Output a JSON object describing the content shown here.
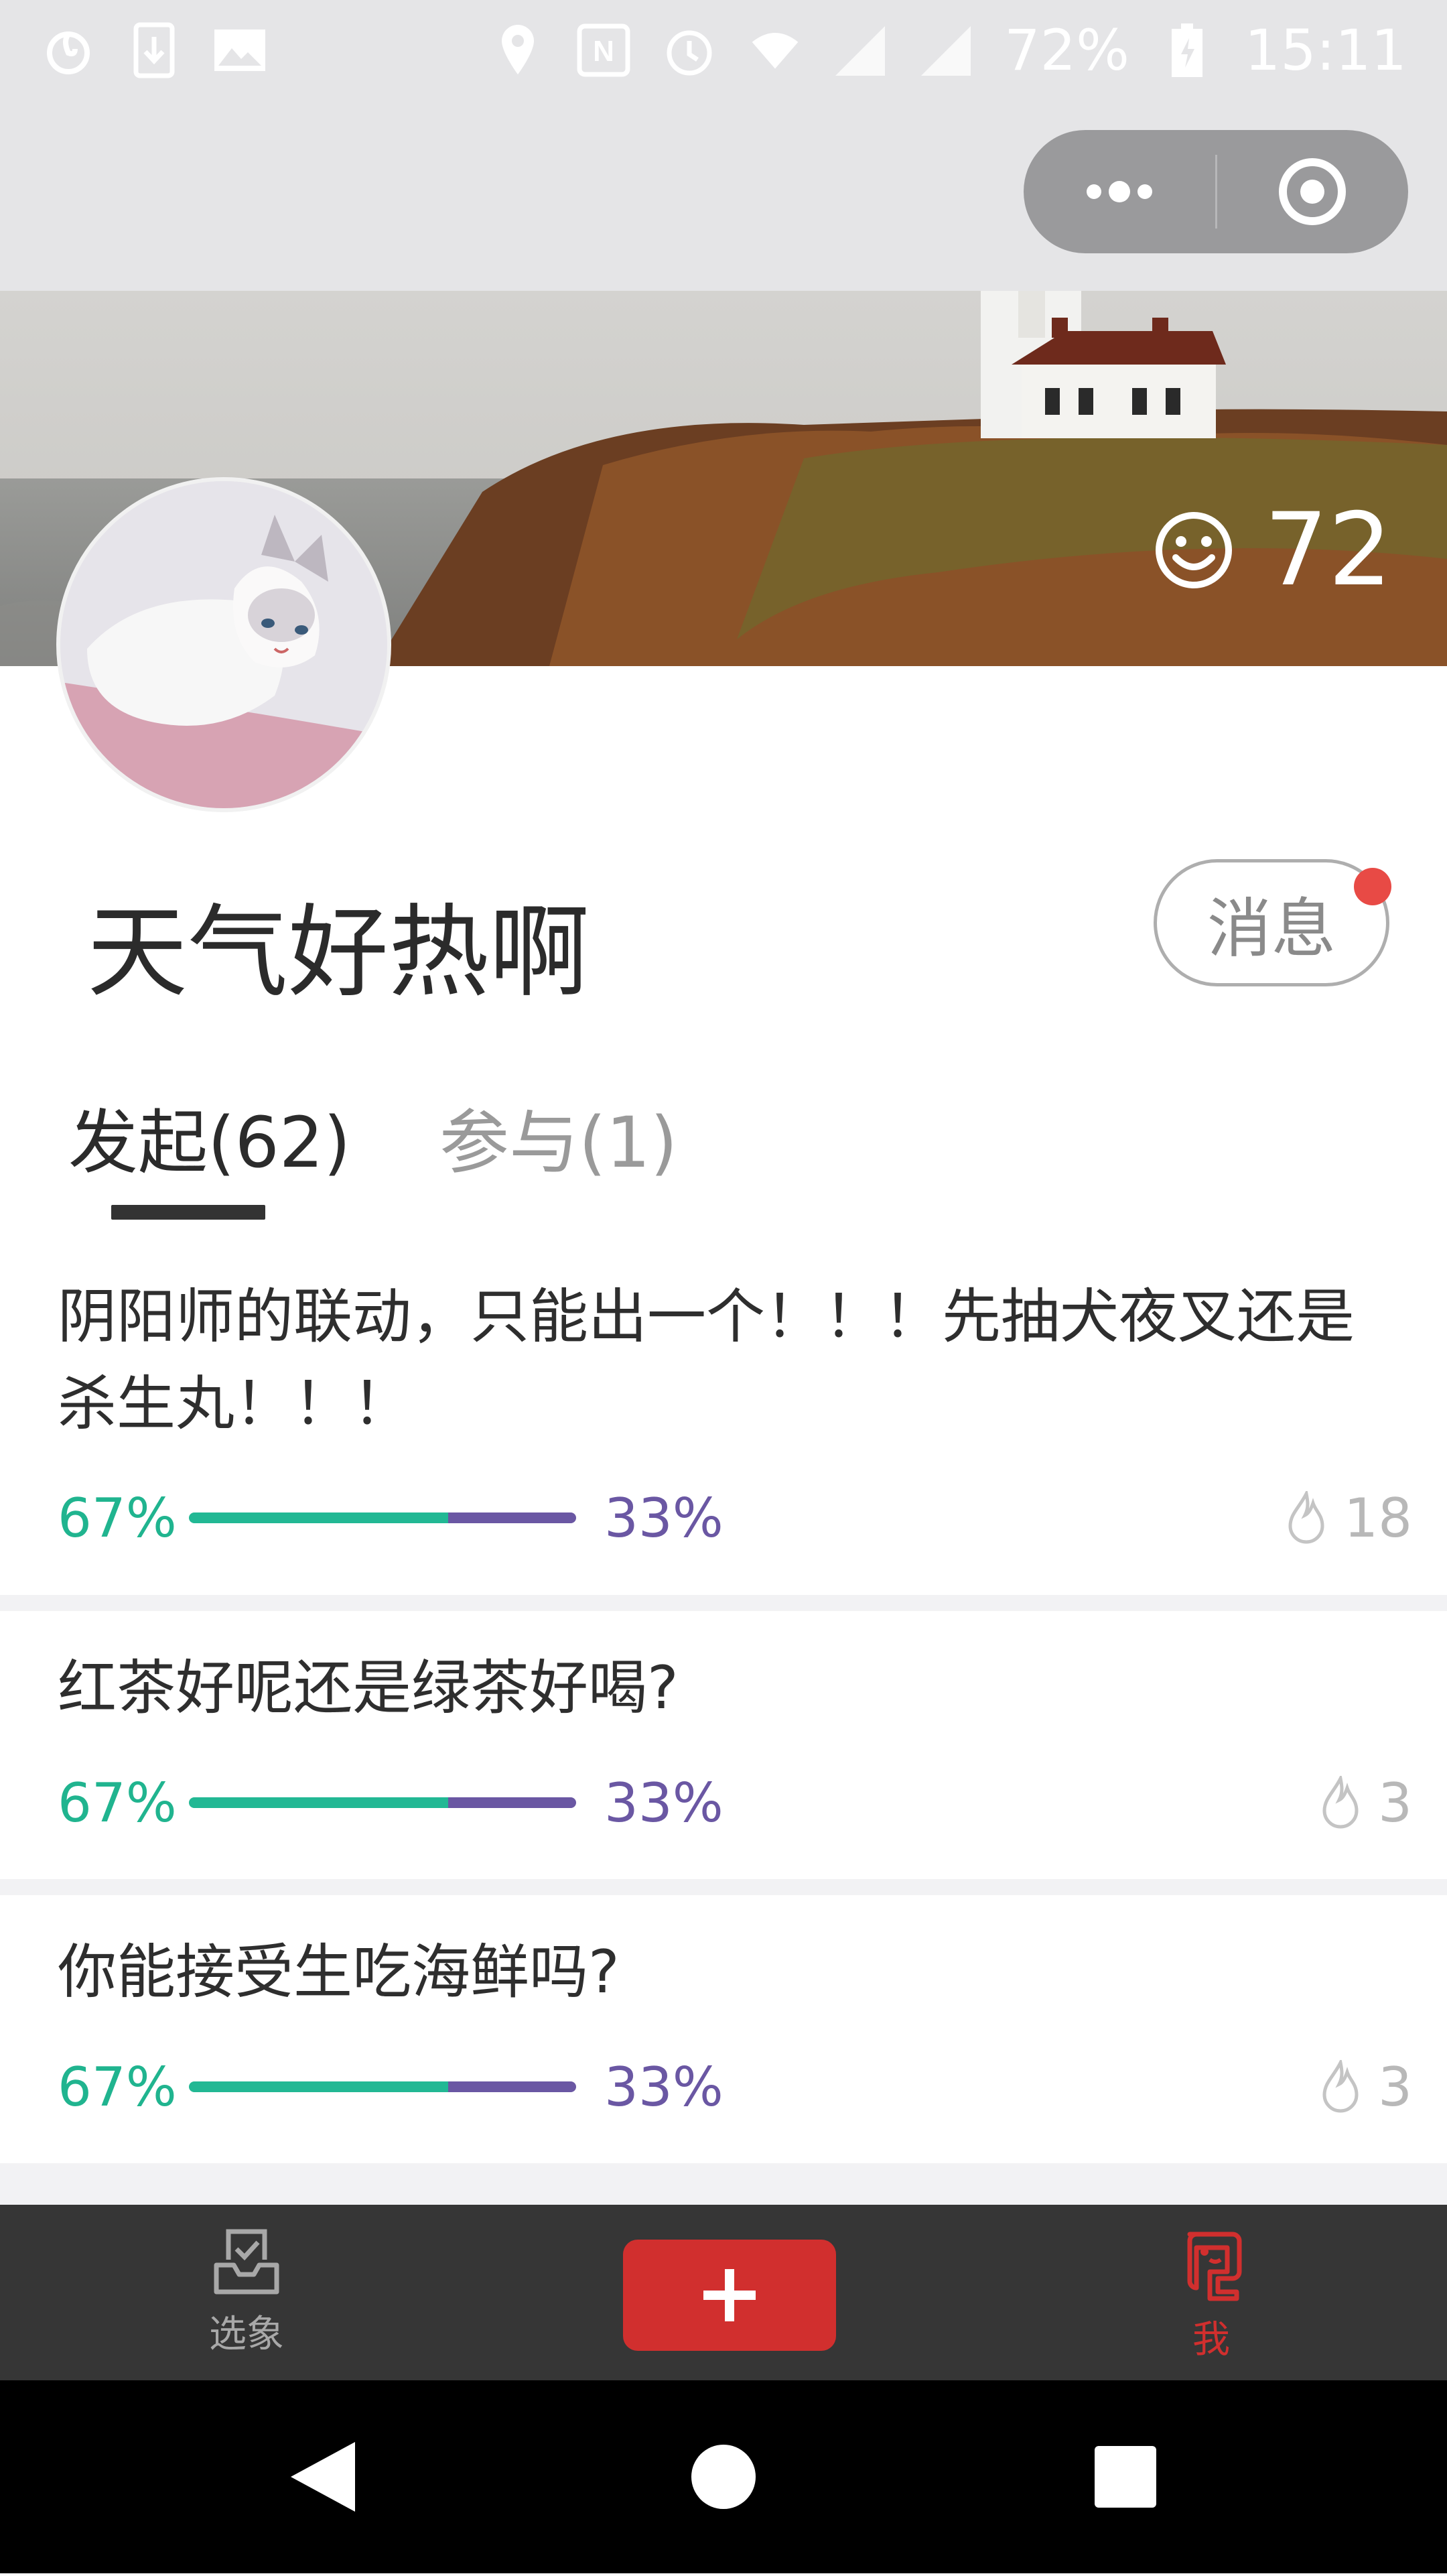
{
  "status_bar": {
    "battery": "72%",
    "time": "15:11",
    "left_icons": [
      "netease-music-icon",
      "download-icon",
      "gallery-icon"
    ],
    "right_icons": [
      "location-icon",
      "nfc-icon",
      "alarm-icon",
      "wifi-icon",
      "signal-icon",
      "signal-icon-2",
      "battery-icon"
    ]
  },
  "nav": {
    "more_icon": "more-dots-icon",
    "close_icon": "target-close-icon"
  },
  "banner": {
    "score_icon": "smiley-icon",
    "score": "72"
  },
  "profile": {
    "name": "天气好热啊",
    "message_button": "消息"
  },
  "tabs": [
    {
      "label": "发起(62)",
      "active": true
    },
    {
      "label": "参与(1)",
      "active": false
    }
  ],
  "questions": [
    {
      "text": "阴阳师的联动，只能出一个！！！先抽犬夜叉还是杀生丸！！！",
      "left_pct": "67%",
      "right_pct": "33%",
      "left_value": 67,
      "heat": "18"
    },
    {
      "text": "红茶好呢还是绿茶好喝?",
      "left_pct": "67%",
      "right_pct": "33%",
      "left_value": 67,
      "heat": "3"
    },
    {
      "text": "你能接受生吃海鲜吗?",
      "left_pct": "67%",
      "right_pct": "33%",
      "left_value": 67,
      "heat": "3"
    }
  ],
  "tabbar": {
    "left_label": "选象",
    "right_label": "我",
    "accent_color": "#d12f2e",
    "inactive_color": "#a8a8a8"
  },
  "colors": {
    "green": "#22b894",
    "purple": "#6a57a3"
  }
}
